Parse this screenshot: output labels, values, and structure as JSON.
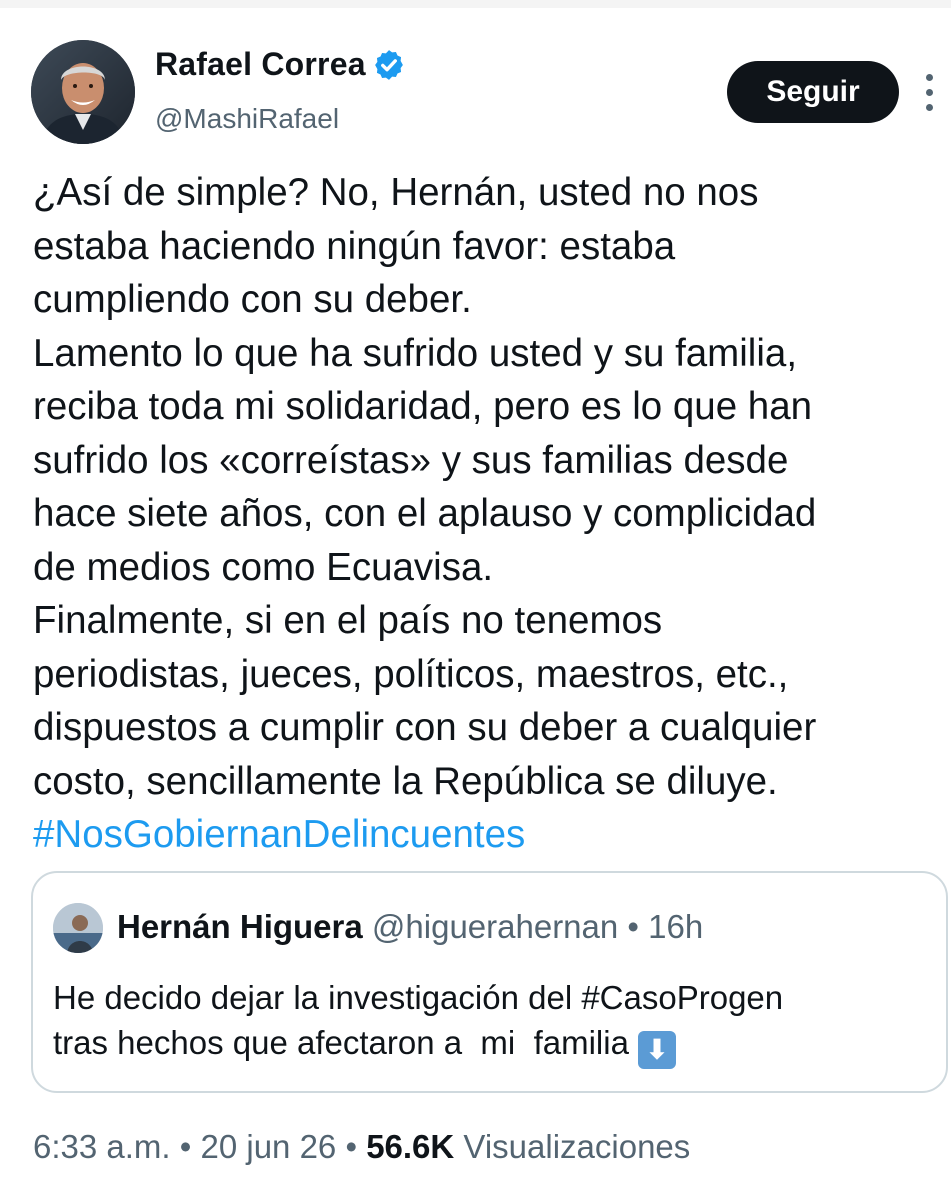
{
  "tweet": {
    "author": {
      "name": "Rafael Correa",
      "handle": "@MashiRafael",
      "verified": true,
      "avatar_icon": "profile-photo-icon"
    },
    "follow_label": "Seguir",
    "more_icon": "more-options-icon",
    "text_lines": [
      "¿Así de simple? No, Hernán, usted no nos",
      "estaba haciendo ningún favor: estaba",
      "cumpliendo con su deber.",
      "Lamento lo que ha sufrido usted y su familia,",
      "reciba toda mi solidaridad, pero es lo que han",
      "sufrido los «correístas» y sus familias desde",
      "hace siete años, con el aplauso y complicidad",
      "de medios como Ecuavisa.",
      "Finalmente, si en el país no tenemos",
      "periodistas, jueces, políticos, maestros, etc.,",
      "dispuestos a cumplir con su deber a cualquier",
      "costo, sencillamente la República se diluye."
    ],
    "hashtag": "#NosGobiernanDelincuentes",
    "quoted": {
      "author_name": "Hernán Higuera",
      "handle": "@higuerahernan",
      "separator": "•",
      "time": "16h",
      "text_line1": "He decido dejar la investigación del #CasoProgen",
      "text_line2": "tras hechos que afectaron a  mi  familia ",
      "emoji": "⬇",
      "emoji_icon": "down-arrow-emoji-icon"
    },
    "footer": {
      "time": "6:33 a.m.",
      "separator": "•",
      "date": "20 jun 26",
      "views_count": "56.6K",
      "views_label": "Visualizaciones"
    },
    "colors": {
      "accent": "#1d9bf0",
      "text": "#0f1419",
      "secondary": "#536471",
      "border": "#cfd9de",
      "button_bg": "#0f1419"
    }
  }
}
